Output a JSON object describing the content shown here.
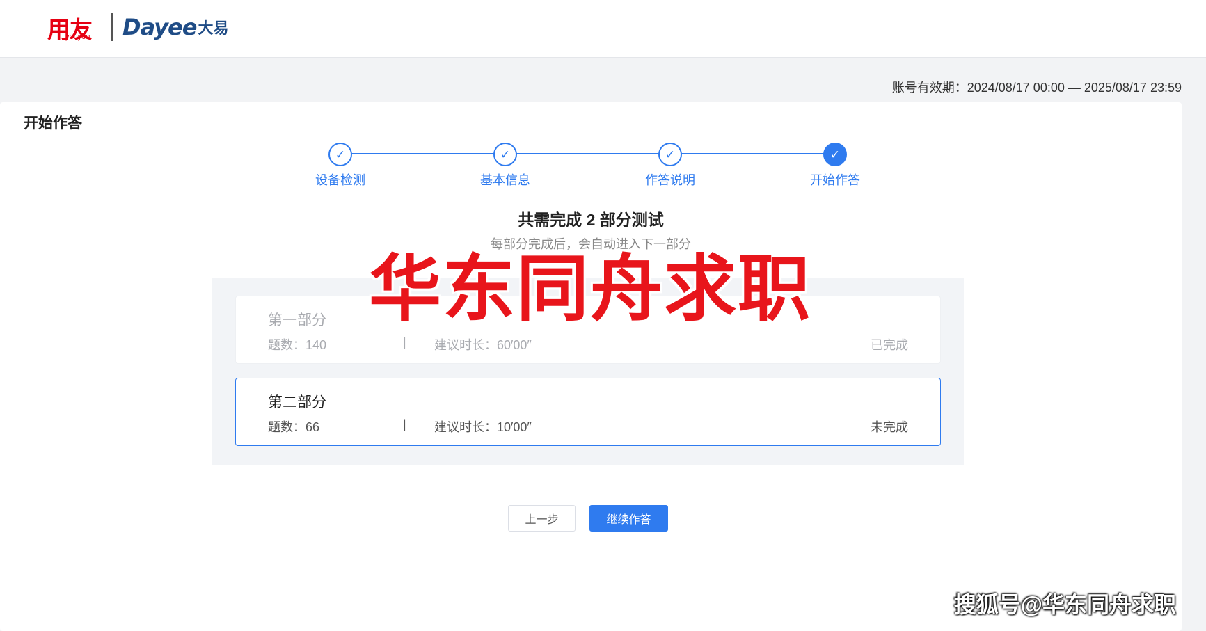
{
  "header": {
    "logo_brand": "用友",
    "logo_brand_sub": "yonyou",
    "logo_partner": "Dayee",
    "logo_partner_cn": "大易"
  },
  "validity": "账号有效期：2024/08/17 00:00 — 2025/08/17 23:59",
  "page_title": "开始作答",
  "steps": [
    {
      "label": "设备检测",
      "icon": "check-icon",
      "state": "done"
    },
    {
      "label": "基本信息",
      "icon": "check-icon",
      "state": "done"
    },
    {
      "label": "作答说明",
      "icon": "check-icon",
      "state": "done"
    },
    {
      "label": "开始作答",
      "icon": "check-icon",
      "state": "current"
    }
  ],
  "summary": {
    "title": "共需完成 2 部分测试",
    "subtitle": "每部分完成后，会自动进入下一部分"
  },
  "parts": [
    {
      "name": "第一部分",
      "count": "题数：140",
      "separator": "|",
      "duration": "建议时长：60′00″",
      "status": "已完成"
    },
    {
      "name": "第二部分",
      "count": "题数：66",
      "separator": "|",
      "duration": "建议时长：10′00″",
      "status": "未完成"
    }
  ],
  "buttons": {
    "prev": "上一步",
    "next": "继续作答"
  },
  "watermarks": {
    "center": "华东同舟求职",
    "corner": "搜狐号@华东同舟求职"
  },
  "colors": {
    "accent": "#2f7bef",
    "brand_red": "#e60012",
    "dayee_blue": "#1f4c86",
    "watermark_red": "#e8151b"
  }
}
